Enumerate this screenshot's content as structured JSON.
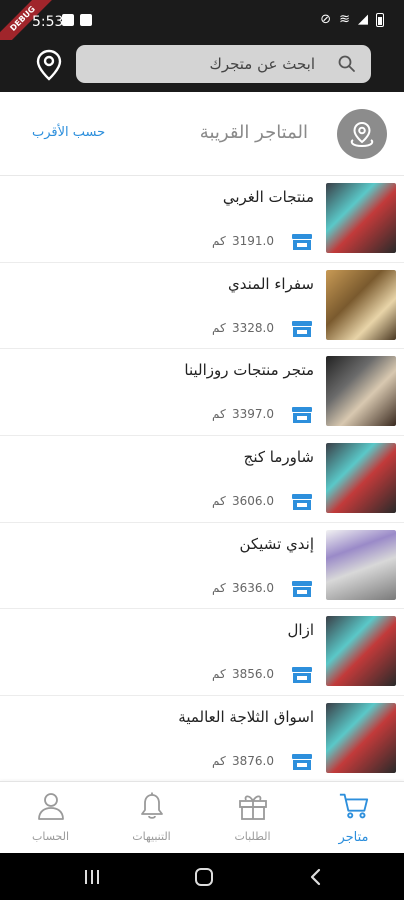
{
  "status_bar": {
    "time": "5:53",
    "debug_banner": "DEBUG"
  },
  "search": {
    "placeholder": "ابحث عن متجرك"
  },
  "section": {
    "title": "المتاجر القريبة",
    "sort_label": "حسب الأقرب"
  },
  "stores": [
    {
      "name": "منتجات الغربي",
      "distance": "3191.0",
      "unit": "كم"
    },
    {
      "name": "سفراء المندي",
      "distance": "3328.0",
      "unit": "كم"
    },
    {
      "name": "متجر منتجات روزالينا",
      "distance": "3397.0",
      "unit": "كم"
    },
    {
      "name": "شاورما كنج",
      "distance": "3606.0",
      "unit": "كم"
    },
    {
      "name": "إندي تشيكن",
      "distance": "3636.0",
      "unit": "كم"
    },
    {
      "name": "ازال",
      "distance": "3856.0",
      "unit": "كم"
    },
    {
      "name": "اسواق الثلاجة العالمية",
      "distance": "3876.0",
      "unit": "كم"
    }
  ],
  "bottom_nav": {
    "stores": "متاجر",
    "orders": "الطلبات",
    "notifications": "التنبيهات",
    "account": "الحساب"
  },
  "colors": {
    "accent": "#2d8fdc",
    "header_bg": "#1b1b1b",
    "muted": "#9a9a9a"
  }
}
